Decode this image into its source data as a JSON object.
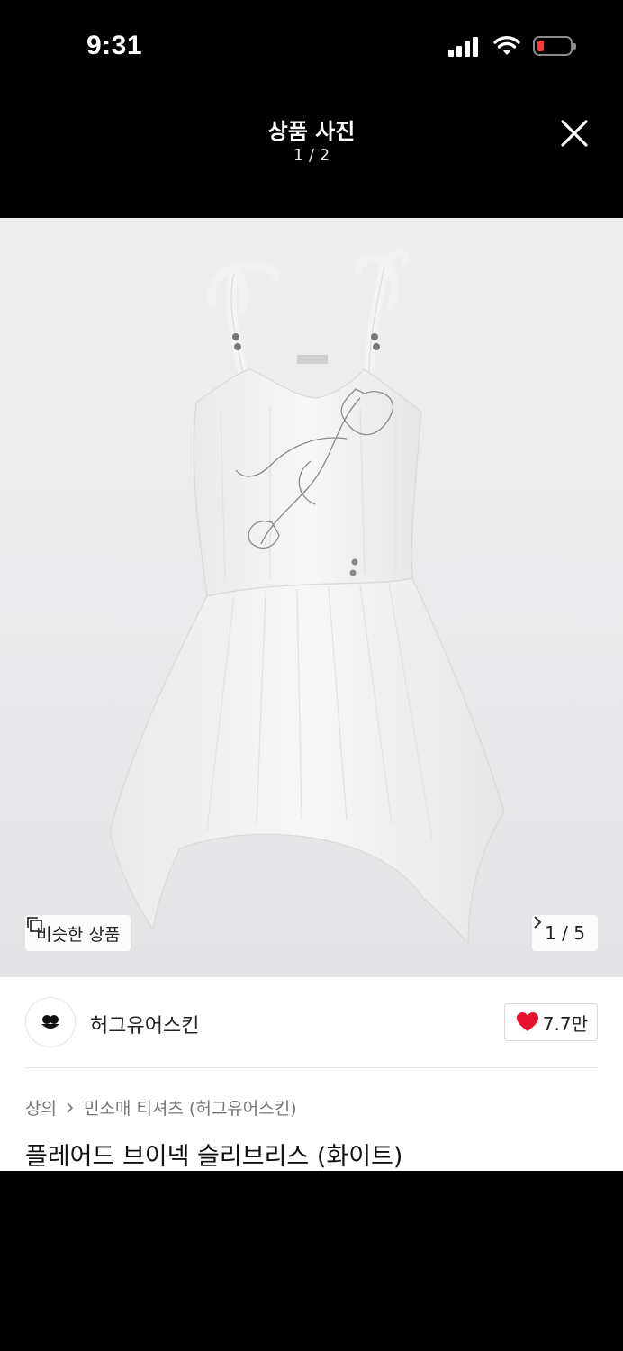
{
  "status_bar": {
    "time": "9:31",
    "icons": [
      "cellular-signal-icon",
      "wifi-icon",
      "battery-low-icon"
    ],
    "battery_color": "#ff3b30"
  },
  "viewer": {
    "title": "상품 사진",
    "counter": "1 / 2",
    "close_icon": "close-icon"
  },
  "image": {
    "similar_label": "비슷한 상품",
    "similar_icon": "copy-icon",
    "page_indicator": "1 / 5",
    "page_icon": "chevron-right-icon"
  },
  "brand": {
    "name": "허그유어스킨",
    "like_count": "7.7만",
    "like_icon": "heart-icon",
    "like_color": "#e8112d"
  },
  "breadcrumb": {
    "category": "상의",
    "subcategory": "민소매 티셔츠 (허그유어스킨)"
  },
  "product": {
    "title": "플레어드 브이넥 슬리브리스 (화이트)"
  }
}
